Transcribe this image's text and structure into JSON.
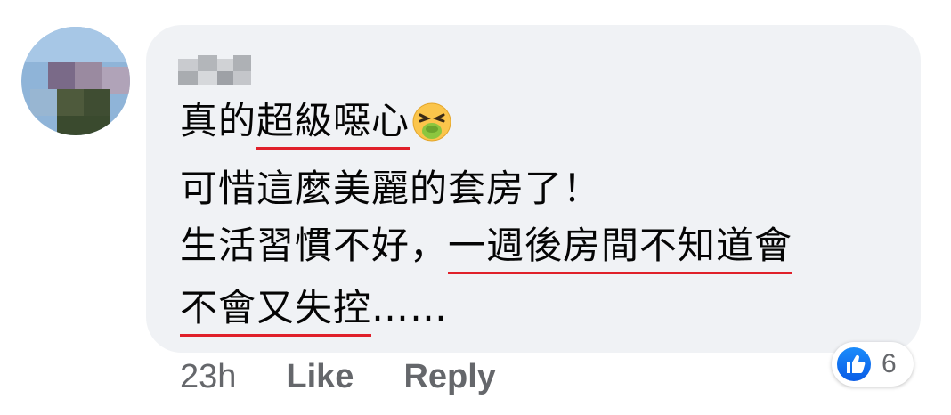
{
  "comment": {
    "avatar_icon": "avatar-pixelated-icon",
    "author_name": "",
    "lines": [
      {
        "prefix": "真的",
        "underlined": "超級噁心",
        "suffix": "",
        "emoji": "nauseated-face-icon"
      },
      {
        "text": "可惜這麼美麗的套房了！"
      },
      {
        "prefix": "生活習慣不好，",
        "underlined": "一週後房間不知道會"
      },
      {
        "underlined": "不會又失控",
        "suffix": "……"
      }
    ],
    "underline_color": "#e0202a"
  },
  "actions": {
    "timestamp": "23h",
    "like_label": "Like",
    "reply_label": "Reply"
  },
  "reactions": {
    "icon": "thumbs-up-icon",
    "count": "6",
    "color": "#1877f2"
  }
}
